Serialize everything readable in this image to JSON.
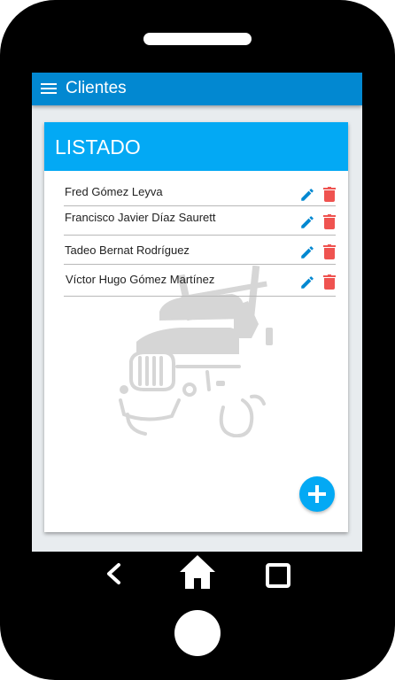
{
  "app_bar": {
    "title": "Clientes",
    "menu_icon": "menu-icon",
    "color": "#0288d1"
  },
  "card": {
    "title": "LISTADO",
    "header_color": "#03a9f4",
    "background_illustration": "truck-illustration"
  },
  "clients": [
    {
      "name": "Fred Gómez Leyva"
    },
    {
      "name": "Francisco Javier Díaz Saurett"
    },
    {
      "name": "Tadeo Bernat Rodríguez"
    },
    {
      "name": "Víctor Hugo Gómez Martínez"
    }
  ],
  "row_actions": {
    "edit_icon": "pencil-icon",
    "delete_icon": "trash-icon",
    "edit_color": "#0288d1",
    "delete_color": "#ef5350"
  },
  "fab": {
    "icon": "plus-icon",
    "color": "#03a9f4"
  },
  "nav_bar": {
    "back_icon": "back-icon",
    "home_icon": "home-icon",
    "recents_icon": "recents-icon"
  }
}
